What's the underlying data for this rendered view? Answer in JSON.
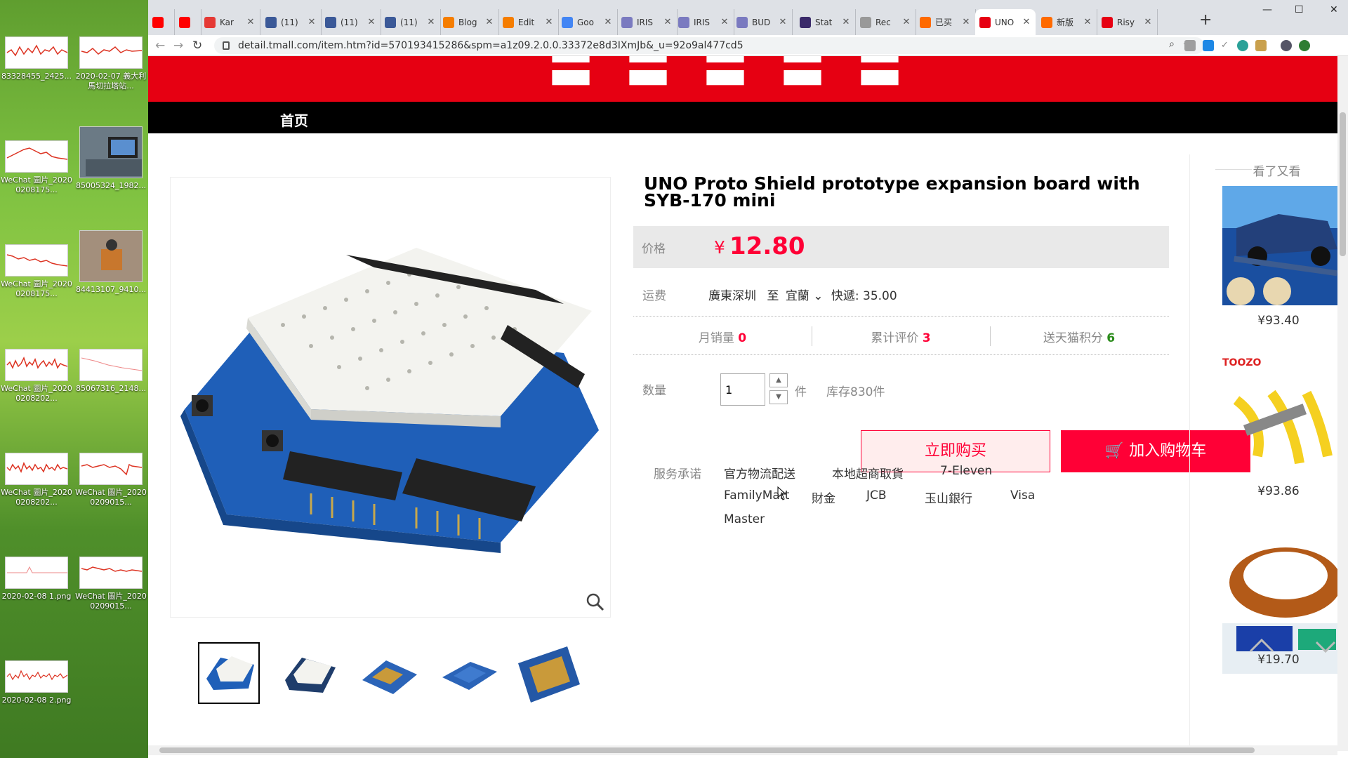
{
  "desktop": {
    "icons": [
      {
        "label": "83328455_2425..."
      },
      {
        "label": "2020-02-07 義大利馬切拉塔站..."
      },
      {
        "label": "WeChat 圖片_20200208175..."
      },
      {
        "label": "85005324_1982..."
      },
      {
        "label": "WeChat 圖片_20200208175..."
      },
      {
        "label": "84413107_9410..."
      },
      {
        "label": "WeChat 圖片_20200208202..."
      },
      {
        "label": "85067316_2148..."
      },
      {
        "label": "WeChat 圖片_20200208202..."
      },
      {
        "label": "WeChat 圖片_20200209015..."
      },
      {
        "label": "2020-02-08 1.png"
      },
      {
        "label": "WeChat 圖片_20200209015..."
      },
      {
        "label": "2020-02-08 2.png"
      }
    ]
  },
  "browser": {
    "tabs": [
      {
        "title": "",
        "icon": "youtube-icon",
        "color": "#ff0000"
      },
      {
        "title": "",
        "icon": "youtube-icon",
        "color": "#ff0000"
      },
      {
        "title": "Kar",
        "icon": "opera-icon",
        "color": "#e53935"
      },
      {
        "title": "(11)",
        "icon": "facebook-icon",
        "color": "#3b5998"
      },
      {
        "title": "(11)",
        "icon": "facebook-icon",
        "color": "#3b5998"
      },
      {
        "title": "(11)",
        "icon": "facebook-icon",
        "color": "#3b5998"
      },
      {
        "title": "Blog",
        "icon": "blogger-icon",
        "color": "#f57d00"
      },
      {
        "title": "Edit",
        "icon": "edit-icon",
        "color": "#f57d00"
      },
      {
        "title": "Goo",
        "icon": "google-translate-icon",
        "color": "#4285f4"
      },
      {
        "title": "IRIS",
        "icon": "iris-icon",
        "color": "#7a7ac0"
      },
      {
        "title": "IRIS",
        "icon": "iris-icon",
        "color": "#7a7ac0"
      },
      {
        "title": "BUD",
        "icon": "iris-icon",
        "color": "#7a7ac0"
      },
      {
        "title": "Stat",
        "icon": "stat-icon",
        "color": "#3a2a6a"
      },
      {
        "title": "Rec",
        "icon": "ship-icon",
        "color": "#999999"
      },
      {
        "title": "已买",
        "icon": "taobao-icon",
        "color": "#ff6a00"
      },
      {
        "title": "UNO",
        "icon": "tmall-icon",
        "color": "#e60012",
        "active": true
      },
      {
        "title": "新版",
        "icon": "taobao-icon",
        "color": "#ff6a00"
      },
      {
        "title": "Risy",
        "icon": "tmall-icon",
        "color": "#e60012"
      }
    ],
    "url": "detail.tmall.com/item.htm?id=570193415286&spm=a1z09.2.0.0.33372e8d3IXmJb&_u=92o9al477cd5"
  },
  "store": {
    "home_label": "首页"
  },
  "product": {
    "title": "UNO Proto Shield prototype expansion board with SYB-170 mini",
    "price_label": "价格",
    "currency": "¥",
    "price": "12.80",
    "shipping_label": "运费",
    "shipping_from": "廣東深圳",
    "shipping_to_word": "至",
    "shipping_dest": "宜蘭",
    "shipping_fee": "快遞: 35.00",
    "stats": [
      {
        "label": "月销量",
        "value": "0"
      },
      {
        "label": "累计评价",
        "value": "3"
      },
      {
        "label": "送天猫积分",
        "value": "6"
      }
    ],
    "qty_label": "数量",
    "qty_value": "1",
    "qty_unit": "件",
    "stock": "库存830件",
    "buy_now": "立即购买",
    "add_cart": "加入购物车",
    "services_label": "服务承诺",
    "services": [
      "官方物流配送",
      "本地超商取貨",
      "7-Eleven",
      "FamilyMart",
      "財金",
      "JCB",
      "玉山銀行",
      "Visa",
      "Master"
    ]
  },
  "sidebar": {
    "title": "看了又看",
    "items": [
      {
        "price": "¥93.40"
      },
      {
        "price": "¥93.86",
        "brand": "TOOZO"
      },
      {
        "price": "¥19.70"
      }
    ]
  },
  "colors": {
    "brand_red": "#e60012",
    "price_red": "#ff0036"
  }
}
